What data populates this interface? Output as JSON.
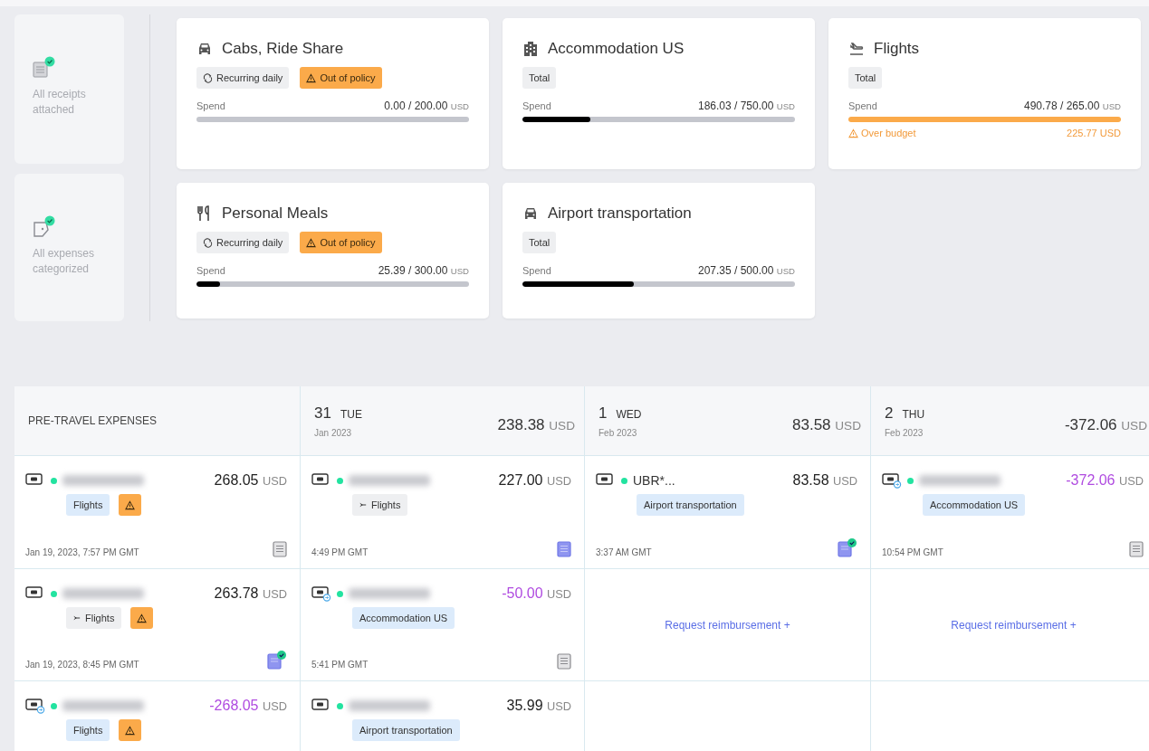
{
  "status_cards": [
    {
      "kind": "receipts",
      "label": "All receipts attached",
      "checked": true
    },
    {
      "kind": "categories",
      "label": "All expenses categorized",
      "checked": true
    }
  ],
  "budgets": [
    {
      "kind": "car",
      "title": "Cabs, Ride Share",
      "tags": [
        {
          "kind": "recurring",
          "label": "Recurring daily"
        },
        {
          "kind": "warning",
          "label": "Out of policy"
        }
      ],
      "spend_label": "Spend",
      "amount": "0.00 / 200.00",
      "currency": "USD",
      "level": 0,
      "over_budget": false
    },
    {
      "kind": "building",
      "title": "Accommodation US",
      "tags": [
        {
          "kind": "total",
          "label": "Total"
        }
      ],
      "spend_label": "Spend",
      "amount": "186.03 / 750.00",
      "currency": "USD",
      "level": 0.25,
      "over_budget": false
    },
    {
      "kind": "plane",
      "title": "Flights",
      "tags": [
        {
          "kind": "total",
          "label": "Total"
        }
      ],
      "spend_label": "Spend",
      "amount": "490.78 / 265.00",
      "currency": "USD",
      "level": 1,
      "over_budget": true,
      "over_label": "Over budget",
      "over_amount": "225.77 USD"
    },
    {
      "kind": "utensils",
      "title": "Personal Meals",
      "tags": [
        {
          "kind": "recurring",
          "label": "Recurring daily"
        },
        {
          "kind": "warning",
          "label": "Out of policy"
        }
      ],
      "spend_label": "Spend",
      "amount": "25.39 / 300.00",
      "currency": "USD",
      "level": 0.085,
      "over_budget": false
    },
    {
      "kind": "car",
      "title": "Airport transportation",
      "tags": [
        {
          "kind": "total",
          "label": "Total"
        }
      ],
      "spend_label": "Spend",
      "amount": "207.35 / 500.00",
      "currency": "USD",
      "level": 0.41,
      "over_budget": false
    }
  ],
  "table": {
    "columns": [
      {
        "kind": "pretravel",
        "title": "PRE-TRAVEL EXPENSES"
      },
      {
        "kind": "day",
        "day": "31",
        "weekday": "TUE",
        "month": "Jan 2023",
        "total": "238.38",
        "currency": "USD"
      },
      {
        "kind": "day",
        "day": "1",
        "weekday": "WED",
        "month": "Feb 2023",
        "total": "83.58",
        "currency": "USD"
      },
      {
        "kind": "day",
        "day": "2",
        "weekday": "THU",
        "month": "Feb 2023",
        "total": "-372.06",
        "currency": "USD"
      }
    ],
    "rows": [
      {
        "cells": [
          {
            "kind": "expense",
            "refund": false,
            "amount": "268.05",
            "currency": "USD",
            "credit": false,
            "tags": [
              {
                "kind": "category",
                "label": "Flights"
              },
              {
                "kind": "warning"
              }
            ],
            "time": "Jan 19, 2023, 7:57 PM GMT",
            "receipt_attached": false,
            "receipt_verified": false
          },
          {
            "kind": "expense",
            "refund": false,
            "amount": "227.00",
            "currency": "USD",
            "credit": false,
            "tags": [
              {
                "kind": "plane",
                "label": "Flights"
              }
            ],
            "time": "4:49 PM GMT",
            "receipt_attached": true,
            "receipt_verified": false
          },
          {
            "kind": "expense",
            "merchant": "UBR*...",
            "refund": false,
            "amount": "83.58",
            "currency": "USD",
            "credit": false,
            "tags": [
              {
                "kind": "category",
                "label": "Airport transportation"
              }
            ],
            "time": "3:37 AM GMT",
            "receipt_attached": true,
            "receipt_verified": true
          },
          {
            "kind": "expense",
            "refund": true,
            "amount": "-372.06",
            "currency": "USD",
            "credit": true,
            "tags": [
              {
                "kind": "category",
                "label": "Accommodation US"
              }
            ],
            "time": "10:54 PM GMT",
            "receipt_attached": false,
            "receipt_verified": false
          }
        ]
      },
      {
        "cells": [
          {
            "kind": "expense",
            "refund": false,
            "amount": "263.78",
            "currency": "USD",
            "credit": false,
            "tags": [
              {
                "kind": "plane",
                "label": "Flights"
              },
              {
                "kind": "warning"
              }
            ],
            "time": "Jan 19, 2023, 8:45 PM GMT",
            "receipt_attached": true,
            "receipt_verified": true
          },
          {
            "kind": "expense",
            "refund": true,
            "amount": "-50.00",
            "currency": "USD",
            "credit": true,
            "tags": [
              {
                "kind": "category",
                "label": "Accommodation US"
              }
            ],
            "time": "5:41 PM GMT",
            "receipt_attached": false,
            "receipt_verified": false
          },
          {
            "kind": "request",
            "label": "Request reimbursement +"
          },
          {
            "kind": "request",
            "label": "Request reimbursement +"
          }
        ]
      },
      {
        "cells": [
          {
            "kind": "expense",
            "refund": true,
            "amount": "-268.05",
            "currency": "USD",
            "credit": true,
            "tags": [
              {
                "kind": "category",
                "label": "Flights"
              },
              {
                "kind": "warning"
              }
            ]
          },
          {
            "kind": "expense",
            "refund": false,
            "amount": "35.99",
            "currency": "USD",
            "credit": false,
            "tags": [
              {
                "kind": "category",
                "label": "Airport transportation"
              }
            ]
          },
          {
            "kind": "empty"
          },
          {
            "kind": "empty"
          }
        ]
      }
    ]
  }
}
